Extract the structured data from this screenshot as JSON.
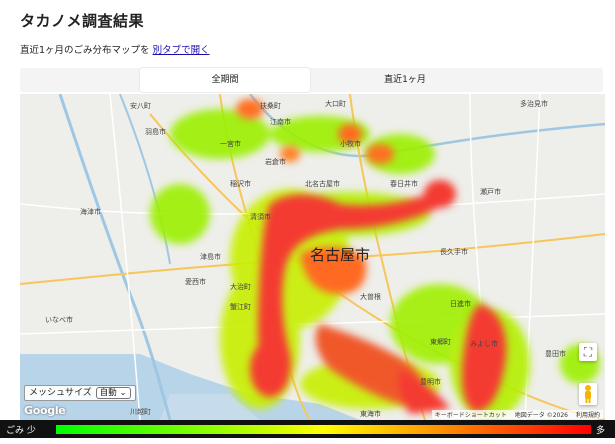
{
  "page": {
    "title": "タカノメ調査結果",
    "subtitle_prefix": "直近1ヶ月のごみ分布マップを",
    "subtitle_link": "別タブで開く"
  },
  "tabs": [
    {
      "label": "全期間",
      "active": true
    },
    {
      "label": "直近1ヶ月",
      "active": false
    }
  ],
  "map": {
    "main_city": "名古屋市",
    "place_labels": [
      "安八町",
      "羽島市",
      "一宮市",
      "江南市",
      "大口町",
      "扶桑町",
      "岩倉市",
      "小牧市",
      "北名古屋市",
      "春日井市",
      "稲沢市",
      "清須市",
      "瀬戸市",
      "津島市",
      "長久手市",
      "愛西市",
      "日進市",
      "東郷町",
      "豊田市",
      "みよし市",
      "蟹江町",
      "大治町",
      "東海市",
      "川越町",
      "いなべ市",
      "海津市",
      "大曽根",
      "豊明市",
      "多治見市"
    ],
    "controls": {
      "mesh_size_label": "メッシュサイズ",
      "mesh_size_value": "自動"
    },
    "attribution": {
      "logo": "Google",
      "keyboard": "キーボードショートカット",
      "map_data": "地図データ ©2026",
      "terms": "利用規約"
    }
  },
  "legend": {
    "label_low": "ごみ 少",
    "label_high": "多",
    "colors": [
      "#00ff00",
      "#ffff00",
      "#ff0000"
    ]
  }
}
